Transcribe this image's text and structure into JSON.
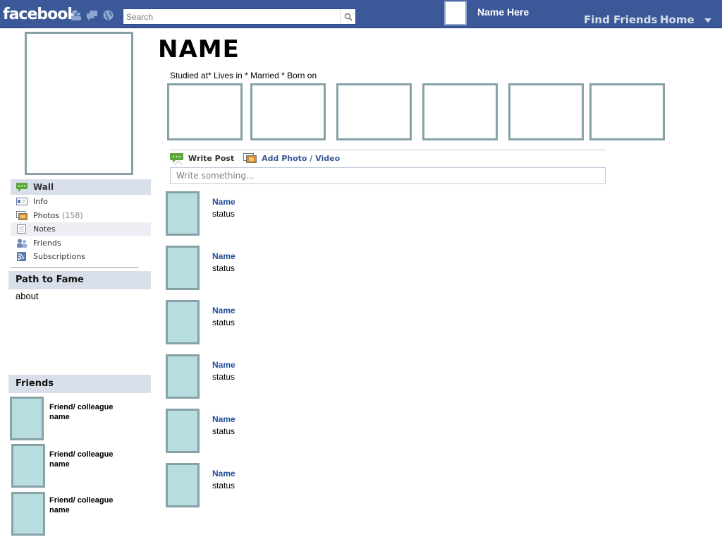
{
  "topbar": {
    "logo": "facebook",
    "jewels": [
      "friend-requests-icon",
      "messages-icon",
      "notifications-globe-icon"
    ],
    "search_placeholder": "Search",
    "user_name": "Name Here",
    "nav": [
      "Find Friends",
      "Home"
    ]
  },
  "profile": {
    "name": "NAME",
    "info_line": "Studied at* Lives in * Married * Born on"
  },
  "left_nav": {
    "items": [
      {
        "label": "Wall",
        "icon": "wall-speech-bubble-icon"
      },
      {
        "label": "Info",
        "icon": "info-card-icon"
      },
      {
        "label": "Photos",
        "count": "(158)",
        "icon": "photos-icon"
      },
      {
        "label": "Notes",
        "icon": "notes-icon"
      },
      {
        "label": "Friends",
        "icon": "friends-icon"
      },
      {
        "label": "Subscriptions",
        "icon": "rss-icon"
      }
    ]
  },
  "path_box": {
    "title": "Path to Fame",
    "body": "about"
  },
  "friends_box": {
    "title": "Friends",
    "items": [
      {
        "name": "Friend/ colleague name"
      },
      {
        "name": "Friend/ colleague name"
      },
      {
        "name": "Friend/ colleague name"
      }
    ]
  },
  "composer": {
    "write_post": "Write Post",
    "add_media": "Add Photo / Video",
    "placeholder": "Write something..."
  },
  "stories": [
    {
      "name": "Name",
      "status": "status"
    },
    {
      "name": "Name",
      "status": "status"
    },
    {
      "name": "Name",
      "status": "status"
    },
    {
      "name": "Name",
      "status": "status"
    },
    {
      "name": "Name",
      "status": "status"
    },
    {
      "name": "Name",
      "status": "status"
    }
  ],
  "colors": {
    "topbar": "#3b5998",
    "frame": "#87a2a7",
    "placeholder_fill": "#b8dde0",
    "section_header": "#d8dfea",
    "link": "#1f4d99"
  }
}
